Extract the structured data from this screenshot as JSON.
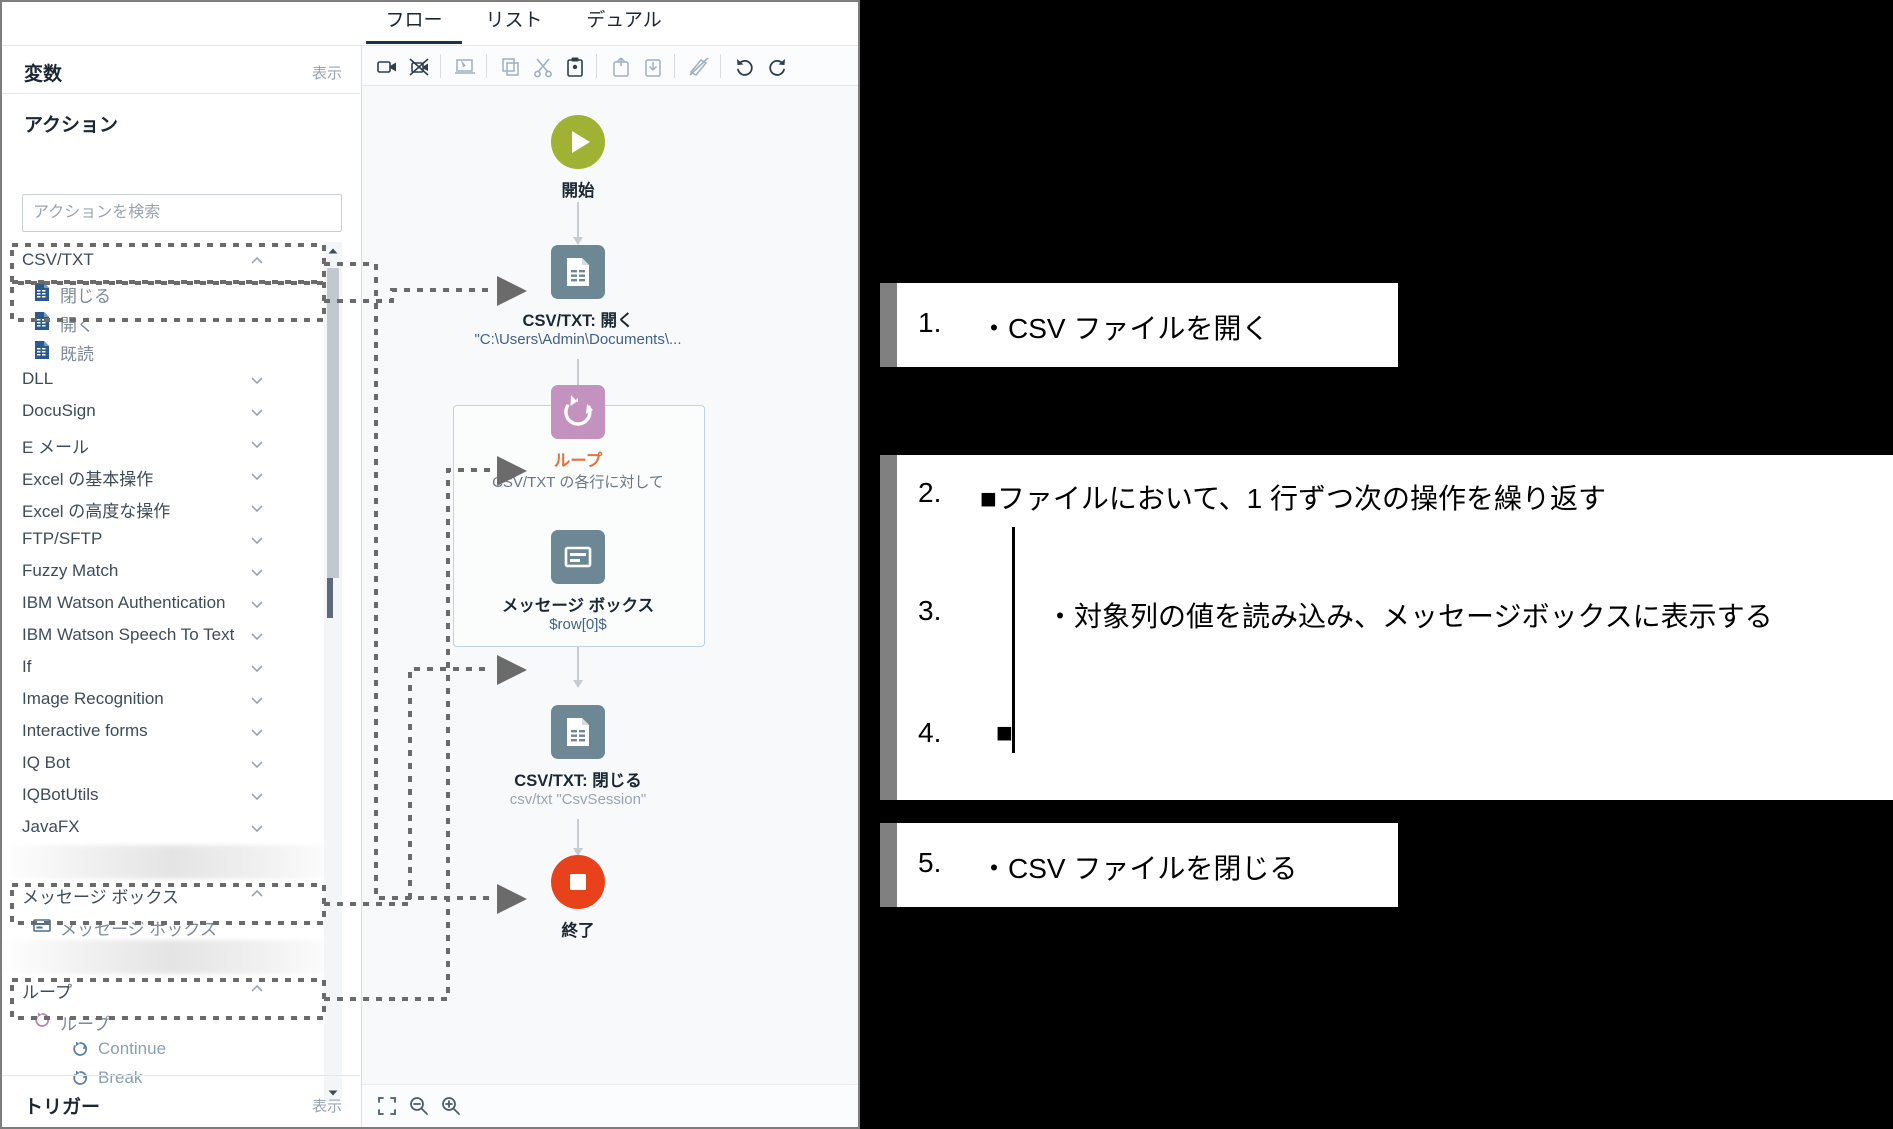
{
  "tabs": [
    {
      "label": "フロー",
      "active": true
    },
    {
      "label": "リスト",
      "active": false
    },
    {
      "label": "デュアル",
      "active": false
    }
  ],
  "left_panel": {
    "variables": {
      "title": "変数",
      "link": "表示"
    },
    "actions": {
      "title": "アクション"
    },
    "search": {
      "placeholder": "アクションを検索",
      "value": ""
    },
    "trigger": {
      "title": "トリガー",
      "link": "表示"
    },
    "tree": [
      {
        "kind": "group",
        "label": "CSV/TXT",
        "chevron": "chevron-up-icon"
      },
      {
        "kind": "leaf",
        "label": "閉じる",
        "icon": "csv-file-icon",
        "indent": 1,
        "highlighted": true
      },
      {
        "kind": "leaf",
        "label": "開く",
        "icon": "csv-file-icon",
        "indent": 1,
        "highlighted": true
      },
      {
        "kind": "leaf",
        "label": "既読",
        "icon": "csv-file-icon",
        "indent": 1,
        "highlighted": false
      },
      {
        "kind": "group",
        "label": "DLL",
        "chevron": "chevron-down-icon"
      },
      {
        "kind": "group",
        "label": "DocuSign",
        "chevron": "chevron-down-icon"
      },
      {
        "kind": "group",
        "label": "E メール",
        "chevron": "chevron-down-icon"
      },
      {
        "kind": "group",
        "label": "Excel の基本操作",
        "chevron": "chevron-down-icon"
      },
      {
        "kind": "group",
        "label": "Excel の高度な操作",
        "chevron": "chevron-down-icon"
      },
      {
        "kind": "group",
        "label": "FTP/SFTP",
        "chevron": "chevron-down-icon"
      },
      {
        "kind": "group",
        "label": "Fuzzy Match",
        "chevron": "chevron-down-icon"
      },
      {
        "kind": "group",
        "label": "IBM Watson Authentication",
        "chevron": "chevron-down-icon"
      },
      {
        "kind": "group",
        "label": "IBM Watson Speech To Text",
        "chevron": "chevron-down-icon"
      },
      {
        "kind": "group",
        "label": "If",
        "chevron": "chevron-down-icon"
      },
      {
        "kind": "group",
        "label": "Image Recognition",
        "chevron": "chevron-down-icon"
      },
      {
        "kind": "group",
        "label": "Interactive forms",
        "chevron": "chevron-down-icon"
      },
      {
        "kind": "group",
        "label": "IQ Bot",
        "chevron": "chevron-down-icon"
      },
      {
        "kind": "group",
        "label": "IQBotUtils",
        "chevron": "chevron-down-icon"
      },
      {
        "kind": "group",
        "label": "JavaFX",
        "chevron": "chevron-down-icon"
      },
      {
        "kind": "blur"
      },
      {
        "kind": "group",
        "label": "メッセージ ボックス",
        "chevron": "chevron-up-icon"
      },
      {
        "kind": "leaf",
        "label": "メッセージ ボックス",
        "icon": "message-box-icon",
        "indent": 1,
        "highlighted": true
      },
      {
        "kind": "blur"
      },
      {
        "kind": "group",
        "label": "ループ",
        "chevron": "chevron-up-icon"
      },
      {
        "kind": "leaf",
        "label": "ループ",
        "icon": "loop-icon",
        "indent": 1,
        "highlighted": true
      },
      {
        "kind": "leaf",
        "label": "Continue",
        "icon": "loop-icon",
        "indent": 2,
        "highlighted": false
      },
      {
        "kind": "leaf",
        "label": "Break",
        "icon": "loop-icon",
        "indent": 2,
        "highlighted": false
      }
    ]
  },
  "toolbar": {
    "items": [
      {
        "name": "record-icon"
      },
      {
        "name": "record-stop-icon"
      },
      {
        "name": "sep"
      },
      {
        "name": "screenshot-icon"
      },
      {
        "name": "sep"
      },
      {
        "name": "copy-icon"
      },
      {
        "name": "cut-icon"
      },
      {
        "name": "paste-icon"
      },
      {
        "name": "sep"
      },
      {
        "name": "export-icon"
      },
      {
        "name": "import-icon"
      },
      {
        "name": "sep"
      },
      {
        "name": "disable-icon"
      },
      {
        "name": "sep"
      },
      {
        "name": "undo-icon"
      },
      {
        "name": "redo-icon"
      }
    ]
  },
  "canvas": {
    "nodes": [
      {
        "id": "start",
        "label": "開始",
        "sub": "",
        "shape": "circle",
        "color": "#9fb233",
        "icon": "play-icon"
      },
      {
        "id": "csv-open",
        "label": "CSV/TXT: 開く",
        "sub": "\"C:\\Users\\Admin\\Documents\\...",
        "shape": "square",
        "color": "#6e8795",
        "icon": "csv-file-icon"
      },
      {
        "id": "loop",
        "label": "ループ",
        "sub": "CSV/TXT の各行に対して",
        "shape": "square",
        "color": "#c492bf",
        "icon": "loop-icon"
      },
      {
        "id": "message-box",
        "label": "メッセージ ボックス",
        "sub": "$row[0]$",
        "shape": "square",
        "color": "#6e8795",
        "icon": "message-box-icon"
      },
      {
        "id": "csv-close",
        "label": "CSV/TXT: 閉じる",
        "sub": "csv/txt \"CsvSession\"",
        "shape": "square",
        "color": "#6e8795",
        "icon": "csv-file-icon"
      },
      {
        "id": "end",
        "label": "終了",
        "sub": "",
        "shape": "circle",
        "color": "#e8421c",
        "icon": "stop-icon"
      }
    ],
    "loop_label_color": "#e2733c",
    "zoom_controls": [
      {
        "name": "fit-to-screen-icon"
      },
      {
        "name": "zoom-out-icon"
      },
      {
        "name": "zoom-in-icon"
      }
    ]
  },
  "annotations": [
    {
      "num": "1.",
      "text": "・CSV ファイルを開く"
    },
    {
      "num": "2.",
      "text": "■ファイルにおいて、1 行ずつ次の操作を繰り返す"
    },
    {
      "num": "3.",
      "text": "・対象列の値を読み込み、メッセージボックスに表示する"
    },
    {
      "num": "4.",
      "text": "■"
    },
    {
      "num": "5.",
      "text": "・CSV ファイルを閉じる"
    }
  ]
}
